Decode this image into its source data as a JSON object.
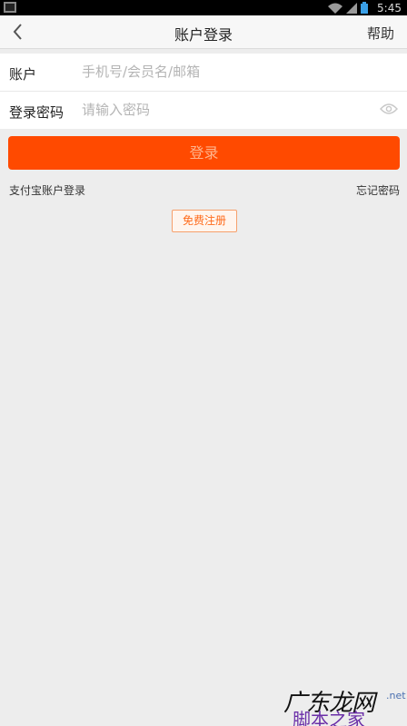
{
  "status_bar": {
    "time": "5:45",
    "icons": [
      "notification-icon",
      "wifi-icon",
      "signal-icon",
      "battery-icon"
    ]
  },
  "header": {
    "title": "账户登录",
    "help_label": "帮助",
    "back_icon": "chevron-left-icon"
  },
  "form": {
    "account_label": "账户",
    "account_placeholder": "手机号/会员名/邮箱",
    "account_value": "",
    "password_label": "登录密码",
    "password_placeholder": "请输入密码",
    "password_value": "",
    "password_toggle_icon": "eye-icon"
  },
  "actions": {
    "login_label": "登录",
    "alipay_login_label": "支付宝账户登录",
    "forgot_password_label": "忘记密码",
    "register_label": "免费注册"
  },
  "watermark": {
    "main": "广东龙网",
    "net": ".net",
    "sub": "脚本之家"
  },
  "colors": {
    "accent": "#ff4a00",
    "background": "#ededed",
    "register_border": "#f6a06c",
    "register_text": "#ff6a1a"
  }
}
